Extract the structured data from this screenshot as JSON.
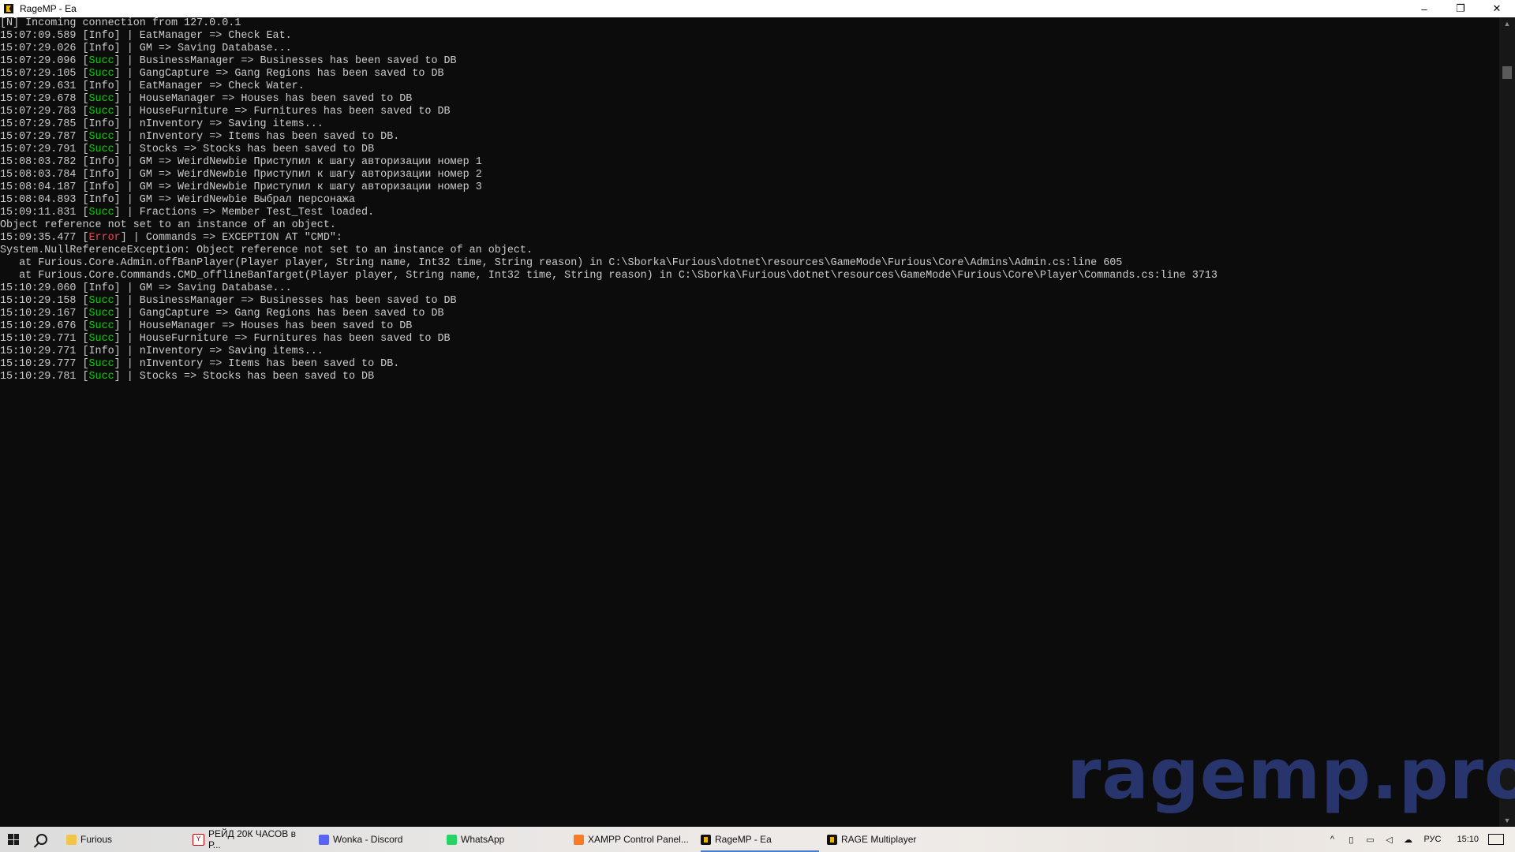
{
  "window": {
    "title": "RageMP - Ea",
    "minimize_glyph": "–",
    "maximize_glyph": "❐",
    "close_glyph": "✕"
  },
  "console": {
    "lines": [
      {
        "prefix": "[N] Incoming connection from 127.0.0.1",
        "level": "",
        "level_type": "",
        "suffix": ""
      },
      {
        "prefix": "15:07:09.589 [",
        "level": "Info",
        "level_type": "info",
        "suffix": "] | EatManager => Check Eat."
      },
      {
        "prefix": "15:07:29.026 [",
        "level": "Info",
        "level_type": "info",
        "suffix": "] | GM => Saving Database..."
      },
      {
        "prefix": "15:07:29.096 [",
        "level": "Succ",
        "level_type": "succ",
        "suffix": "] | BusinessManager => Businesses has been saved to DB"
      },
      {
        "prefix": "15:07:29.105 [",
        "level": "Succ",
        "level_type": "succ",
        "suffix": "] | GangCapture => Gang Regions has been saved to DB"
      },
      {
        "prefix": "15:07:29.631 [",
        "level": "Info",
        "level_type": "info",
        "suffix": "] | EatManager => Check Water."
      },
      {
        "prefix": "15:07:29.678 [",
        "level": "Succ",
        "level_type": "succ",
        "suffix": "] | HouseManager => Houses has been saved to DB"
      },
      {
        "prefix": "15:07:29.783 [",
        "level": "Succ",
        "level_type": "succ",
        "suffix": "] | HouseFurniture => Furnitures has been saved to DB"
      },
      {
        "prefix": "15:07:29.785 [",
        "level": "Info",
        "level_type": "info",
        "suffix": "] | nInventory => Saving items..."
      },
      {
        "prefix": "15:07:29.787 [",
        "level": "Succ",
        "level_type": "succ",
        "suffix": "] | nInventory => Items has been saved to DB."
      },
      {
        "prefix": "15:07:29.791 [",
        "level": "Succ",
        "level_type": "succ",
        "suffix": "] | Stocks => Stocks has been saved to DB"
      },
      {
        "prefix": "15:08:03.782 [",
        "level": "Info",
        "level_type": "info",
        "suffix": "] | GM => WeirdNewbie Приступил к шагу авторизации номер 1"
      },
      {
        "prefix": "15:08:03.784 [",
        "level": "Info",
        "level_type": "info",
        "suffix": "] | GM => WeirdNewbie Приступил к шагу авторизации номер 2"
      },
      {
        "prefix": "15:08:04.187 [",
        "level": "Info",
        "level_type": "info",
        "suffix": "] | GM => WeirdNewbie Приступил к шагу авторизации номер 3"
      },
      {
        "prefix": "15:08:04.893 [",
        "level": "Info",
        "level_type": "info",
        "suffix": "] | GM => WeirdNewbie Выбрал персонажа"
      },
      {
        "prefix": "15:09:11.831 [",
        "level": "Succ",
        "level_type": "succ",
        "suffix": "] | Fractions => Member Test_Test loaded."
      },
      {
        "prefix": "Object reference not set to an instance of an object.",
        "level": "",
        "level_type": "",
        "suffix": ""
      },
      {
        "prefix": "15:09:35.477 [",
        "level": "Error",
        "level_type": "error",
        "suffix": "] | Commands => EXCEPTION AT \"CMD\":"
      },
      {
        "prefix": "System.NullReferenceException: Object reference not set to an instance of an object.",
        "level": "",
        "level_type": "",
        "suffix": ""
      },
      {
        "prefix": "   at Furious.Core.Admin.offBanPlayer(Player player, String name, Int32 time, String reason) in C:\\Sborka\\Furious\\dotnet\\resources\\GameMode\\Furious\\Core\\Admins\\Admin.cs:line 605",
        "level": "",
        "level_type": "",
        "suffix": ""
      },
      {
        "prefix": "   at Furious.Core.Commands.CMD_offlineBanTarget(Player player, String name, Int32 time, String reason) in C:\\Sborka\\Furious\\dotnet\\resources\\GameMode\\Furious\\Core\\Player\\Commands.cs:line 3713",
        "level": "",
        "level_type": "",
        "suffix": ""
      },
      {
        "prefix": "15:10:29.060 [",
        "level": "Info",
        "level_type": "info",
        "suffix": "] | GM => Saving Database..."
      },
      {
        "prefix": "15:10:29.158 [",
        "level": "Succ",
        "level_type": "succ",
        "suffix": "] | BusinessManager => Businesses has been saved to DB"
      },
      {
        "prefix": "15:10:29.167 [",
        "level": "Succ",
        "level_type": "succ",
        "suffix": "] | GangCapture => Gang Regions has been saved to DB"
      },
      {
        "prefix": "15:10:29.676 [",
        "level": "Succ",
        "level_type": "succ",
        "suffix": "] | HouseManager => Houses has been saved to DB"
      },
      {
        "prefix": "15:10:29.771 [",
        "level": "Succ",
        "level_type": "succ",
        "suffix": "] | HouseFurniture => Furnitures has been saved to DB"
      },
      {
        "prefix": "15:10:29.771 [",
        "level": "Info",
        "level_type": "info",
        "suffix": "] | nInventory => Saving items..."
      },
      {
        "prefix": "15:10:29.777 [",
        "level": "Succ",
        "level_type": "succ",
        "suffix": "] | nInventory => Items has been saved to DB."
      },
      {
        "prefix": "15:10:29.781 [",
        "level": "Succ",
        "level_type": "succ",
        "suffix": "] | Stocks => Stocks has been saved to DB"
      }
    ],
    "colors": {
      "text": "#cccccc",
      "succ": "#16c60c",
      "error": "#e74856",
      "background": "#0c0c0c"
    }
  },
  "watermark": {
    "text": "ragemp.pro",
    "color": "#2c3a78"
  },
  "scrollbar": {
    "up_glyph": "▲",
    "down_glyph": "▼"
  },
  "taskbar": {
    "items": [
      {
        "label": "Furious",
        "icon": "folder-icon"
      },
      {
        "label": "РЕЙД 20К ЧАСОВ в Р...",
        "icon": "yandex-browser-icon"
      },
      {
        "label": "Wonka - Discord",
        "icon": "discord-icon"
      },
      {
        "label": "WhatsApp",
        "icon": "whatsapp-icon"
      },
      {
        "label": "XAMPP Control Panel...",
        "icon": "xampp-icon"
      },
      {
        "label": "RageMP - Ea",
        "icon": "ragemp-icon"
      },
      {
        "label": "RAGE Multiplayer",
        "icon": "ragemp-icon"
      }
    ],
    "tray": {
      "chevron_glyph": "^",
      "language": "РУС",
      "clock": "15:10"
    }
  }
}
